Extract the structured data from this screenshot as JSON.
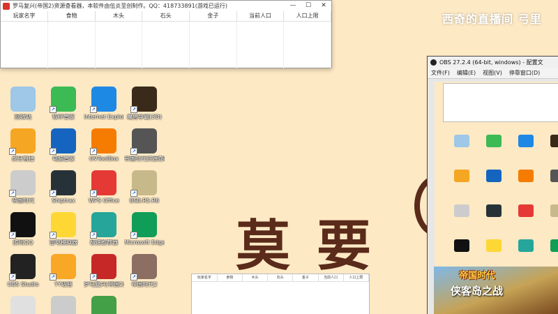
{
  "viewer": {
    "title": "罗马复兴(帝国2)资源查看器，本软件由伍炎至创制作。QQ：418733891(游戏已运行)",
    "columns": [
      "玩家名字",
      "食物",
      "木头",
      "石头",
      "金子",
      "当前人口",
      "人口上限"
    ],
    "minimize": "—",
    "maximize": "☐",
    "close": "✕"
  },
  "viewer2": {
    "columns": [
      "玩家名字",
      "食物",
      "木头",
      "石头",
      "金子",
      "当前人口",
      "人口上限"
    ]
  },
  "watermark": "西奇的直播间 弓里",
  "desktop_icons": [
    {
      "label": "回收站",
      "icon": "recycle-bin",
      "color": "#9ec7e8"
    },
    {
      "label": "软件管家",
      "icon": "software-manager",
      "color": "#3cba54"
    },
    {
      "label": "Internet Explorer",
      "icon": "ie",
      "color": "#1e88e5"
    },
    {
      "label": "魔兽争霸(3D)",
      "icon": "warcraft",
      "color": "#3a2a1a"
    },
    {
      "label": "虎牙直播",
      "icon": "huya",
      "color": "#f5a623"
    },
    {
      "label": "电脑管家",
      "icon": "pc-manager",
      "color": "#1565c0"
    },
    {
      "label": "OVToolBox",
      "icon": "ovtoolbox",
      "color": "#f57c00"
    },
    {
      "label": "帝国时代资源查看",
      "icon": "aoe-viewer",
      "color": "#555555"
    },
    {
      "label": "帝国时代",
      "icon": "dragon",
      "color": "#cccccc"
    },
    {
      "label": "Shiptrax",
      "icon": "shiptrax",
      "color": "#263238"
    },
    {
      "label": "WPS Office",
      "icon": "wps",
      "color": "#e53935"
    },
    {
      "label": "BSB.R5.R6",
      "icon": "bsb",
      "color": "#c8b98a"
    },
    {
      "label": "腾讯QQ",
      "icon": "qq",
      "color": "#111111"
    },
    {
      "label": "雷电模拟器",
      "icon": "emulator",
      "color": "#fdd835"
    },
    {
      "label": "极速推荐器",
      "icon": "recommender",
      "color": "#26a69a"
    },
    {
      "label": "Microsoft Edge",
      "icon": "edge",
      "color": "#0f9d58"
    },
    {
      "label": "OBS Studio",
      "icon": "obs",
      "color": "#222222"
    },
    {
      "label": "YY语音",
      "icon": "yy",
      "color": "#f9a825"
    },
    {
      "label": "罗马复兴(帝国2)资源查看",
      "icon": "rome-viewer",
      "color": "#c62828"
    },
    {
      "label": "帝国时代2",
      "icon": "aoe2",
      "color": "#8d6e63"
    },
    {
      "label": "",
      "icon": "bear",
      "color": "#e0e0e0"
    },
    {
      "label": "",
      "icon": "dragon2",
      "color": "#cccccc"
    },
    {
      "label": "",
      "icon": "e-browser",
      "color": "#43a047"
    }
  ],
  "obs": {
    "title": "OBS 27.2.4 (64-bit, windows) - 配置文",
    "menu": [
      "文件(F)",
      "编辑(E)",
      "视图(V)",
      "停靠窗口(D)"
    ]
  },
  "game_ad": {
    "title": "帝国时代",
    "subtitle": "侠客岛之战"
  },
  "calligraphy": "莫要",
  "colors": {
    "desktop_bg": "#fde9c4",
    "calligraphy": "#5a2a1a"
  }
}
